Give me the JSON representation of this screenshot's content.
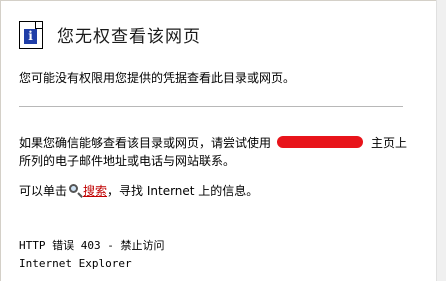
{
  "page": {
    "title": "您无权查看该网页",
    "subtitle": "您可能没有权限用您提供的凭据查看此目录或网页。"
  },
  "advice": {
    "line1_before": "如果您确信能够查看该目录或网页，请尝试使用",
    "line1_after": "主页上",
    "line2": "所列的电子邮件地址或电话与网站联系。"
  },
  "search": {
    "prefix": "可以单击",
    "link_label": "搜索",
    "suffix": "，寻找 Internet 上的信息。"
  },
  "error": {
    "code_line": "HTTP 错误 403 - 禁止访问",
    "browser": "Internet Explorer"
  },
  "colors": {
    "link": "#c00000",
    "redaction": "#e8141a",
    "info_badge": "#1f3ea8"
  },
  "icons": [
    "info-page-icon",
    "search-icon"
  ]
}
